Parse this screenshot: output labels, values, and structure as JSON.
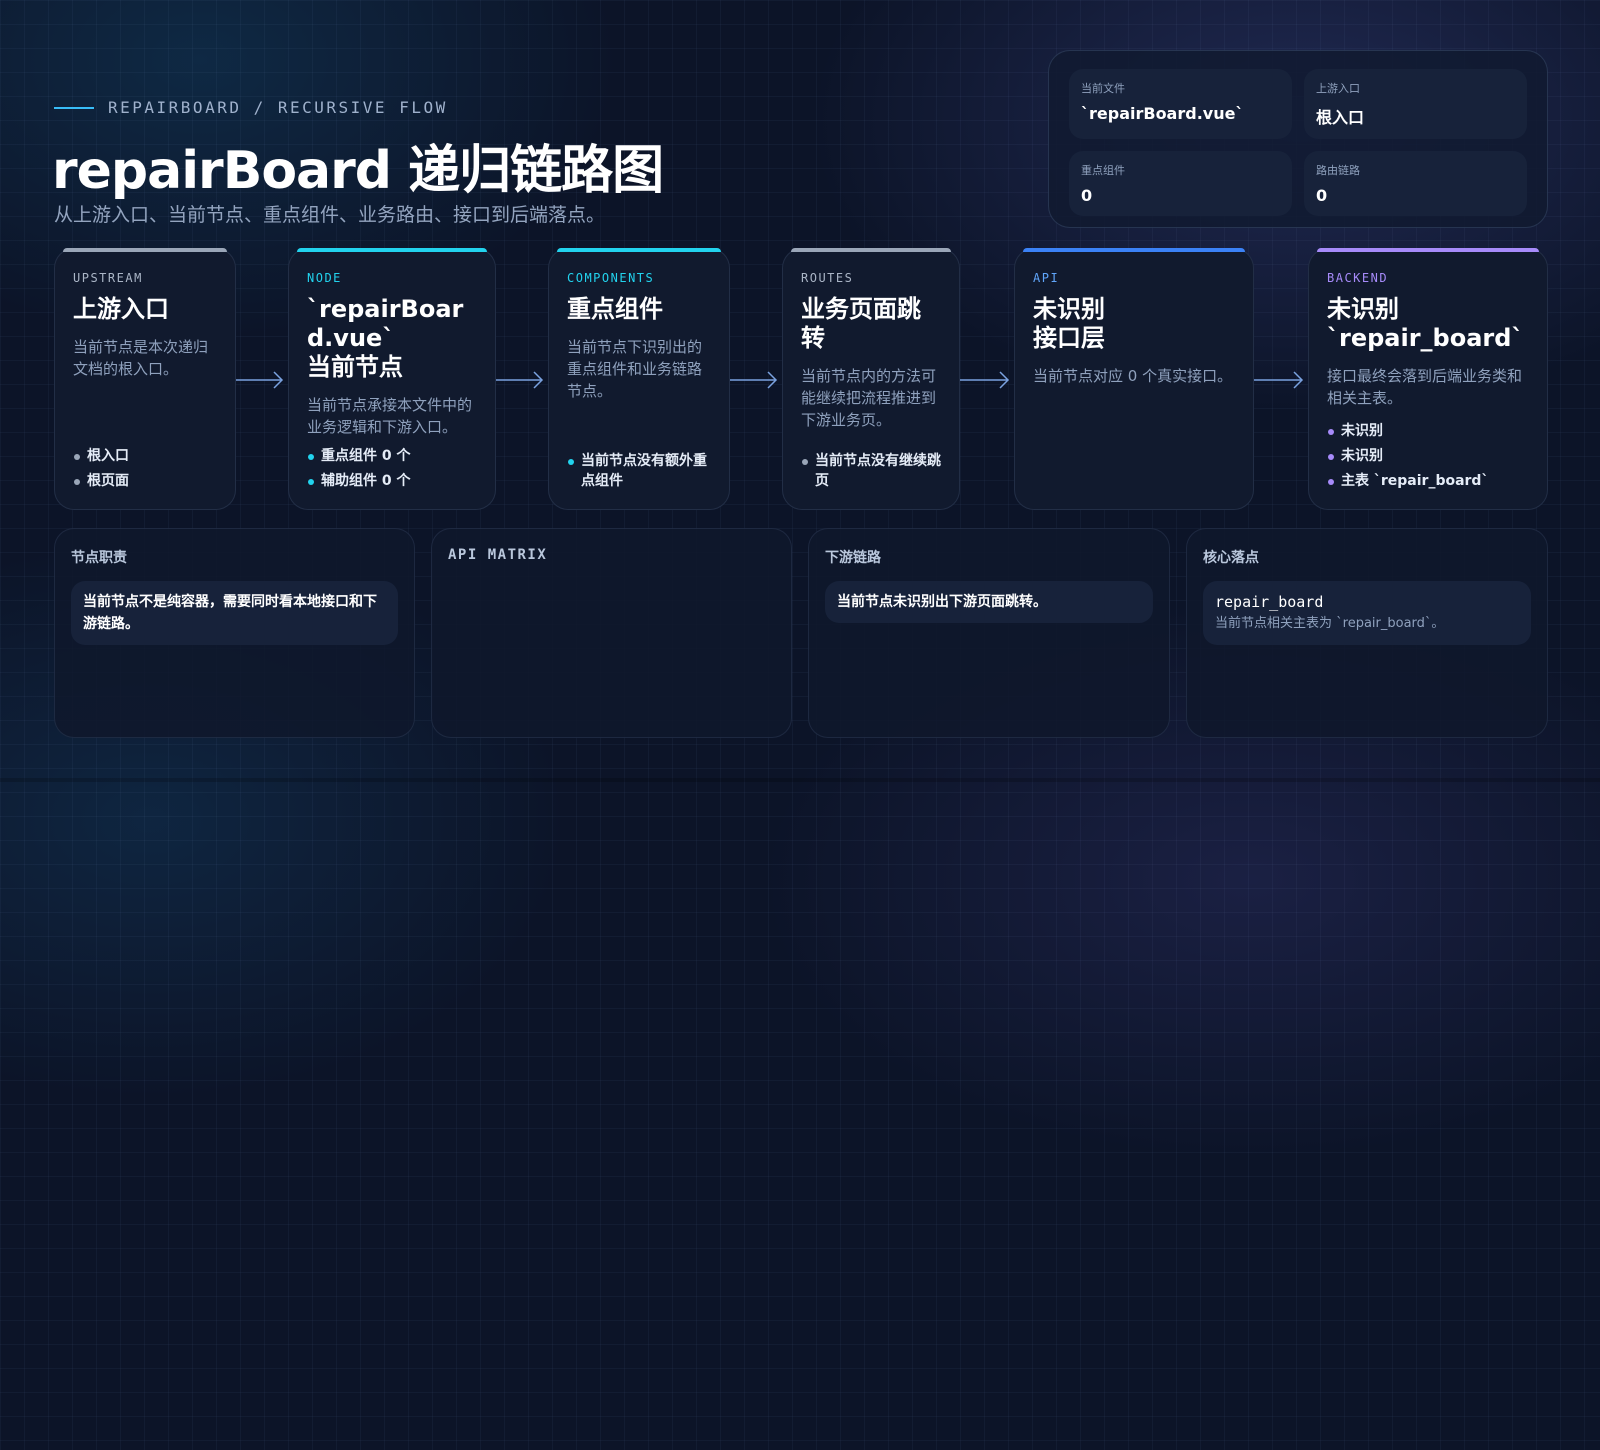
{
  "header": {
    "eyebrow": "REPAIRBOARD / RECURSIVE FLOW",
    "title": "repairBoard 递归链路图",
    "subtitle": "从上游入口、当前节点、重点组件、业务路由、接口到后端落点。"
  },
  "stats": [
    {
      "label": "当前文件",
      "value": "`repairBoard.vue`"
    },
    {
      "label": "上游入口",
      "value": "根入口"
    },
    {
      "label": "重点组件",
      "value": "0"
    },
    {
      "label": "路由链路",
      "value": "0"
    }
  ],
  "colors": {
    "upstream": "#9aa6b8",
    "node": "#22d3ee",
    "components": "#22d3ee",
    "routes": "#9aa6b8",
    "api": "#3b82f6",
    "backend": "#a78bfa"
  },
  "flow": [
    {
      "tag": "UPSTREAM",
      "title": "上游入口",
      "desc": "当前节点是本次递归文档的根入口。",
      "items": [
        "根入口",
        "根页面"
      ]
    },
    {
      "tag": "NODE",
      "title": "`repairBoard.vue`\n当前节点",
      "desc": "当前节点承接本文件中的业务逻辑和下游入口。",
      "items": [
        "重点组件 0 个",
        "辅助组件 0 个"
      ]
    },
    {
      "tag": "COMPONENTS",
      "title": "重点组件",
      "desc": "当前节点下识别出的重点组件和业务链路节点。",
      "items": [
        "当前节点没有额外重点组件"
      ]
    },
    {
      "tag": "ROUTES",
      "title": "业务页面跳转",
      "desc": "当前节点内的方法可能继续把流程推进到下游业务页。",
      "items": [
        "当前节点没有继续跳页"
      ]
    },
    {
      "tag": "API",
      "title": "未识别\n接口层",
      "desc": "当前节点对应 0 个真实接口。",
      "items": []
    },
    {
      "tag": "BACKEND",
      "title": "未识别\n`repair_board`",
      "desc": "接口最终会落到后端业务类和相关主表。",
      "items": [
        "未识别",
        "未识别",
        "主表 `repair_board`"
      ]
    }
  ],
  "panels": {
    "duty": {
      "title": "节点职责",
      "text": "当前节点不是纯容器，需要同时看本地接口和下游链路。"
    },
    "api": {
      "title": "API MATRIX"
    },
    "downstream": {
      "title": "下游链路",
      "text": "当前节点未识别出下游页面跳转。"
    },
    "core": {
      "title": "核心落点",
      "code": "repair_board",
      "note": "当前节点相关主表为 `repair_board`。"
    }
  }
}
